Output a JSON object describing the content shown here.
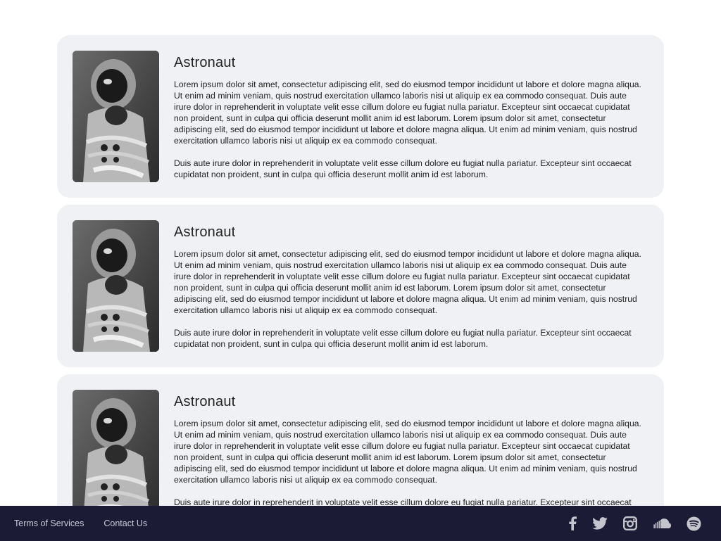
{
  "cards": [
    {
      "title": "Astronaut",
      "paragraph1": "Lorem ipsum dolor sit amet, consectetur adipiscing elit, sed do eiusmod tempor incididunt ut labore et dolore magna aliqua. Ut enim ad minim veniam, quis nostrud exercitation ullamco laboris nisi ut aliquip ex ea commodo consequat. Duis aute irure dolor in reprehenderit in voluptate velit esse cillum dolore eu fugiat nulla pariatur. Excepteur sint occaecat cupidatat non proident, sunt in culpa qui officia deserunt mollit anim id est laborum. Lorem ipsum dolor sit amet, consectetur adipiscing elit, sed do eiusmod tempor incididunt ut labore et dolore magna aliqua. Ut enim ad minim veniam, quis nostrud exercitation ullamco laboris nisi ut aliquip ex ea commodo consequat.",
      "paragraph2": "Duis aute irure dolor in reprehenderit in voluptate velit esse cillum dolore eu fugiat nulla pariatur. Excepteur sint occaecat cupidatat non proident, sunt in culpa qui officia deserunt mollit anim id est laborum."
    },
    {
      "title": "Astronaut",
      "paragraph1": "Lorem ipsum dolor sit amet, consectetur adipiscing elit, sed do eiusmod tempor incididunt ut labore et dolore magna aliqua. Ut enim ad minim veniam, quis nostrud exercitation ullamco laboris nisi ut aliquip ex ea commodo consequat. Duis aute irure dolor in reprehenderit in voluptate velit esse cillum dolore eu fugiat nulla pariatur. Excepteur sint occaecat cupidatat non proident, sunt in culpa qui officia deserunt mollit anim id est laborum. Lorem ipsum dolor sit amet, consectetur adipiscing elit, sed do eiusmod tempor incididunt ut labore et dolore magna aliqua. Ut enim ad minim veniam, quis nostrud exercitation ullamco laboris nisi ut aliquip ex ea commodo consequat.",
      "paragraph2": "Duis aute irure dolor in reprehenderit in voluptate velit esse cillum dolore eu fugiat nulla pariatur. Excepteur sint occaecat cupidatat non proident, sunt in culpa qui officia deserunt mollit anim id est laborum."
    },
    {
      "title": "Astronaut",
      "paragraph1": "Lorem ipsum dolor sit amet, consectetur adipiscing elit, sed do eiusmod tempor incididunt ut labore et dolore magna aliqua. Ut enim ad minim veniam, quis nostrud exercitation ullamco laboris nisi ut aliquip ex ea commodo consequat. Duis aute irure dolor in reprehenderit in voluptate velit esse cillum dolore eu fugiat nulla pariatur. Excepteur sint occaecat cupidatat non proident, sunt in culpa qui officia deserunt mollit anim id est laborum. Lorem ipsum dolor sit amet, consectetur adipiscing elit, sed do eiusmod tempor incididunt ut labore et dolore magna aliqua. Ut enim ad minim veniam, quis nostrud exercitation ullamco laboris nisi ut aliquip ex ea commodo consequat.",
      "paragraph2": "Duis aute irure dolor in reprehenderit in voluptate velit esse cillum dolore eu fugiat nulla pariatur. Excepteur sint occaecat cupidatat non proident, sunt in culpa qui officia deserunt mollit anim id est laborum."
    }
  ],
  "footer": {
    "links": [
      "Terms of Services",
      "Contact Us"
    ],
    "social_icons": [
      "facebook-icon",
      "twitter-icon",
      "instagram-icon",
      "soundcloud-icon",
      "spotify-icon"
    ]
  },
  "colors": {
    "card_background": "#f0f1f5",
    "footer_background": "#1c1b36",
    "footer_link": "#c9c9d6",
    "social_icon": "#c4c4cc"
  }
}
